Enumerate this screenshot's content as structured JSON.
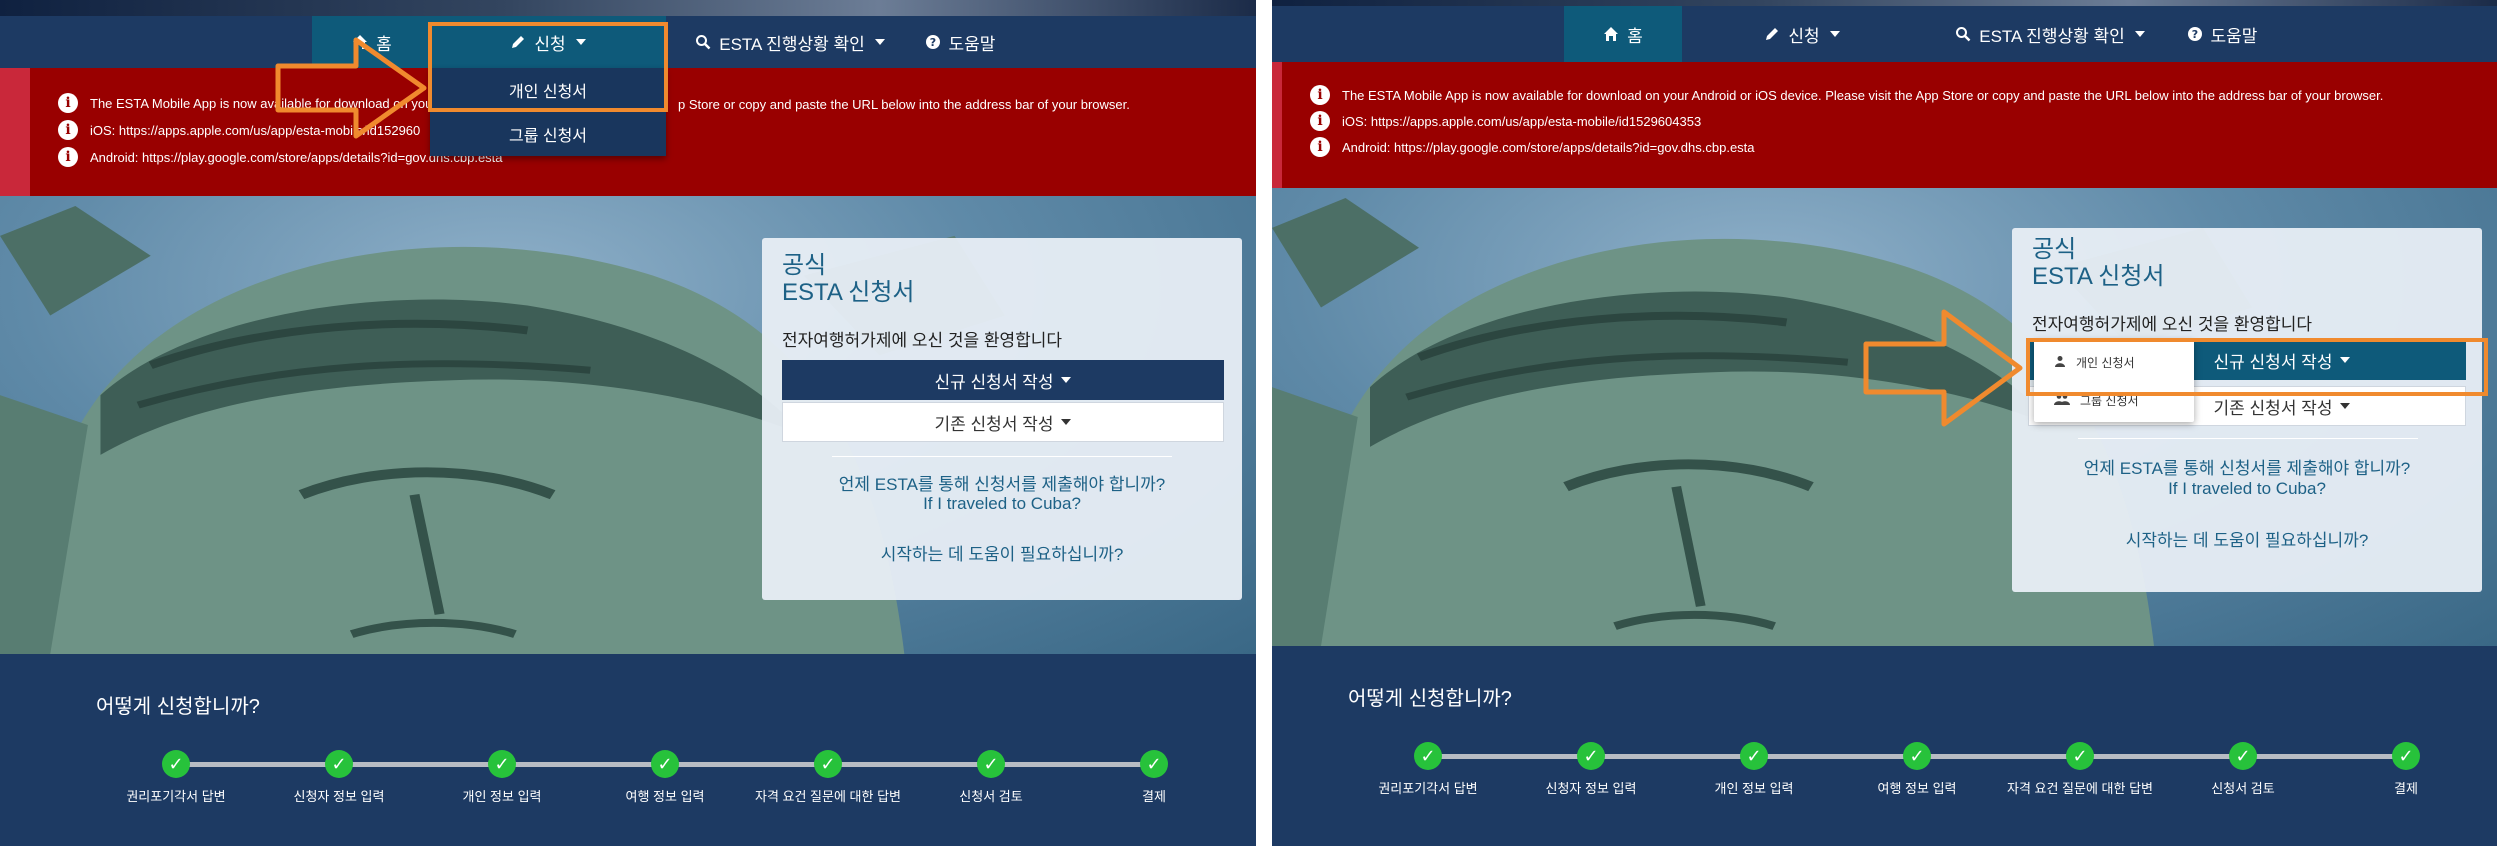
{
  "nav": {
    "home": "홈",
    "apply": "신청",
    "status": "ESTA 진행상황 확인",
    "help": "도움말"
  },
  "alert": {
    "left_line1": "The ESTA Mobile App is now available for download on your",
    "left_line1_tail": "p Store or copy and paste the URL below into the address bar of your browser.",
    "left_line2": "iOS: https://apps.apple.com/us/app/esta-mobile/id152960",
    "left_line3": "Android: https://play.google.com/store/apps/details?id=gov.dhs.cbp.esta",
    "right_line1": "The ESTA Mobile App is now available for download on your Android or iOS device. Please visit the App Store or copy and paste the URL below into the address bar of your browser.",
    "right_line2": "iOS: https://apps.apple.com/us/app/esta-mobile/id1529604353",
    "right_line3": "Android: https://play.google.com/store/apps/details?id=gov.dhs.cbp.esta"
  },
  "card": {
    "title_line1": "공식",
    "title_line2": "ESTA 신청서",
    "welcome": "전자여행허가제에 오신 것을 환영합니다",
    "new_app": "신규 신청서 작성",
    "new_app_right": "신규 신청서 작성",
    "existing_app": "기존 신청서 작성",
    "existing_app_right": "기존 신청서 작성",
    "when_submit": "언제 ESTA를 통해 신청서를 제출해야 합니까?",
    "cuba": "If I traveled to Cuba?",
    "need_help": "시작하는 데 도움이 필요하십니까?"
  },
  "dropdown": {
    "individual": "개인 신청서",
    "group": "그룹 신청서"
  },
  "steps": {
    "title": "어떻게 신청합니까?",
    "items": [
      "권리포기각서 답변",
      "신청자 정보 입력",
      "개인 정보 입력",
      "여행 정보 입력",
      "자격 요건 질문에 대한 답변",
      "신청서 검토",
      "결제"
    ]
  },
  "colors": {
    "navy": "#1d3a63",
    "alert_red": "#990000",
    "teal": "#0e5a7a",
    "annotation_orange": "#f08a2e",
    "step_green": "#27c23b"
  }
}
